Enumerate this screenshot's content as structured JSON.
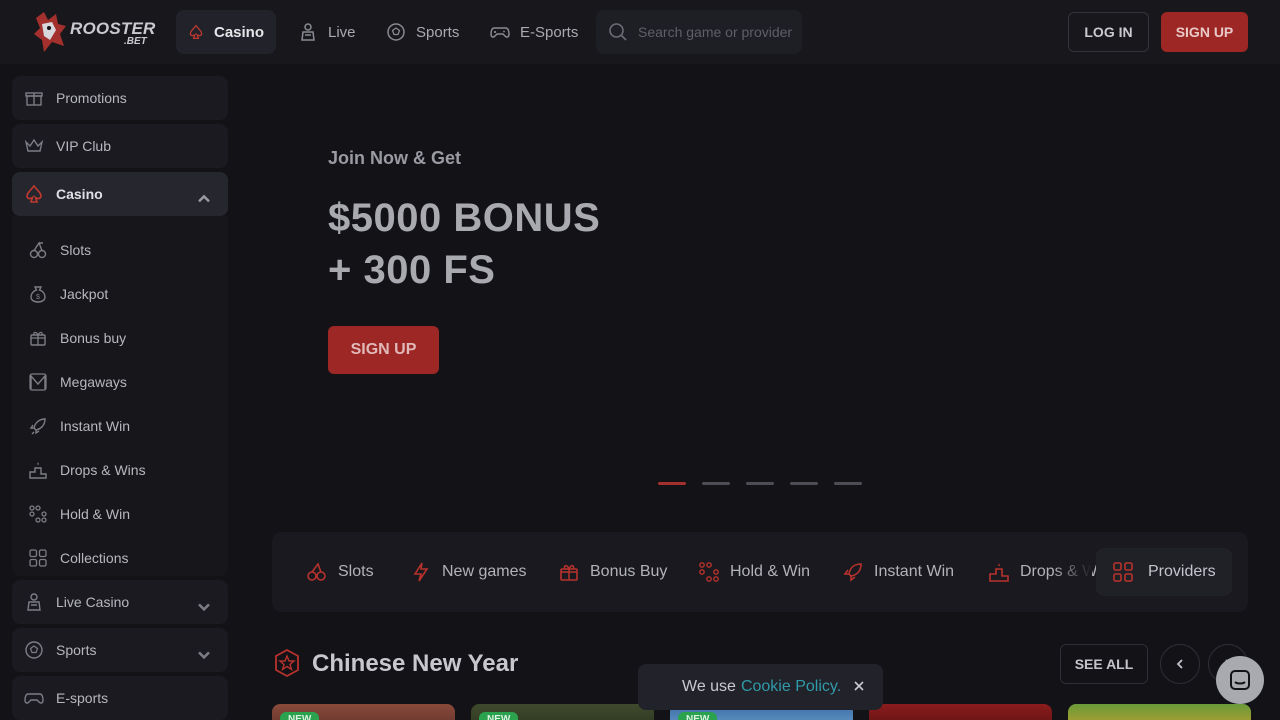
{
  "brand": {
    "name": "ROOSTER",
    "suffix": ".BET"
  },
  "nav": {
    "items": [
      {
        "label": "Casino",
        "icon": "spade-icon"
      },
      {
        "label": "Live",
        "icon": "dealer-icon"
      },
      {
        "label": "Sports",
        "icon": "soccer-ball-icon"
      },
      {
        "label": "E-Sports",
        "icon": "gamepad-icon"
      }
    ],
    "search_placeholder": "Search game or provider",
    "login_label": "LOG IN",
    "signup_label": "SIGN UP"
  },
  "sidebar": {
    "top_items": [
      {
        "label": "Promotions",
        "icon": "gift-icon"
      },
      {
        "label": "VIP Club",
        "icon": "crown-icon"
      }
    ],
    "casino": {
      "label": "Casino",
      "icon": "spade-icon",
      "expanded": true,
      "items": [
        {
          "label": "Slots",
          "icon": "cherries-icon"
        },
        {
          "label": "Jackpot",
          "icon": "money-bag-icon"
        },
        {
          "label": "Bonus buy",
          "icon": "gift-box-icon"
        },
        {
          "label": "Megaways",
          "icon": "megaways-icon"
        },
        {
          "label": "Instant Win",
          "icon": "rocket-icon"
        },
        {
          "label": "Drops & Wins",
          "icon": "podium-icon"
        },
        {
          "label": "Hold & Win",
          "icon": "dots-grid-icon"
        },
        {
          "label": "Collections",
          "icon": "collections-icon"
        }
      ]
    },
    "bottom_items": [
      {
        "label": "Live Casino",
        "icon": "dealer-icon"
      },
      {
        "label": "Sports",
        "icon": "soccer-ball-icon"
      },
      {
        "label": "E-sports",
        "icon": "gamepad-icon"
      }
    ]
  },
  "hero": {
    "subtitle": "Join Now & Get",
    "title_line1": "$5000 BONUS",
    "title_line2": "+ 300 FS",
    "button_label": "SIGN UP",
    "slides_count": 5,
    "active_slide": 1
  },
  "categories": {
    "items": [
      {
        "label": "Slots",
        "icon": "cherries-icon"
      },
      {
        "label": "New games",
        "icon": "lightning-icon"
      },
      {
        "label": "Bonus Buy",
        "icon": "gift-box-icon"
      },
      {
        "label": "Hold & Win",
        "icon": "dots-grid-icon"
      },
      {
        "label": "Instant Win",
        "icon": "rocket-icon"
      },
      {
        "label": "Drops & Wins",
        "icon": "podium-icon"
      }
    ],
    "providers_label": "Providers"
  },
  "section": {
    "title": "Chinese New Year",
    "see_all_label": "SEE ALL",
    "thumb_badges": [
      "NEW",
      "NEW",
      "NEW",
      "",
      ""
    ]
  },
  "cookie": {
    "text": "We use",
    "link_label": "Cookie Policy."
  },
  "colors": {
    "accent": "#9c2724",
    "background": "#121217",
    "header": "#17171c",
    "badge_new": "#2aa24e",
    "link": "#2f9aa8"
  }
}
